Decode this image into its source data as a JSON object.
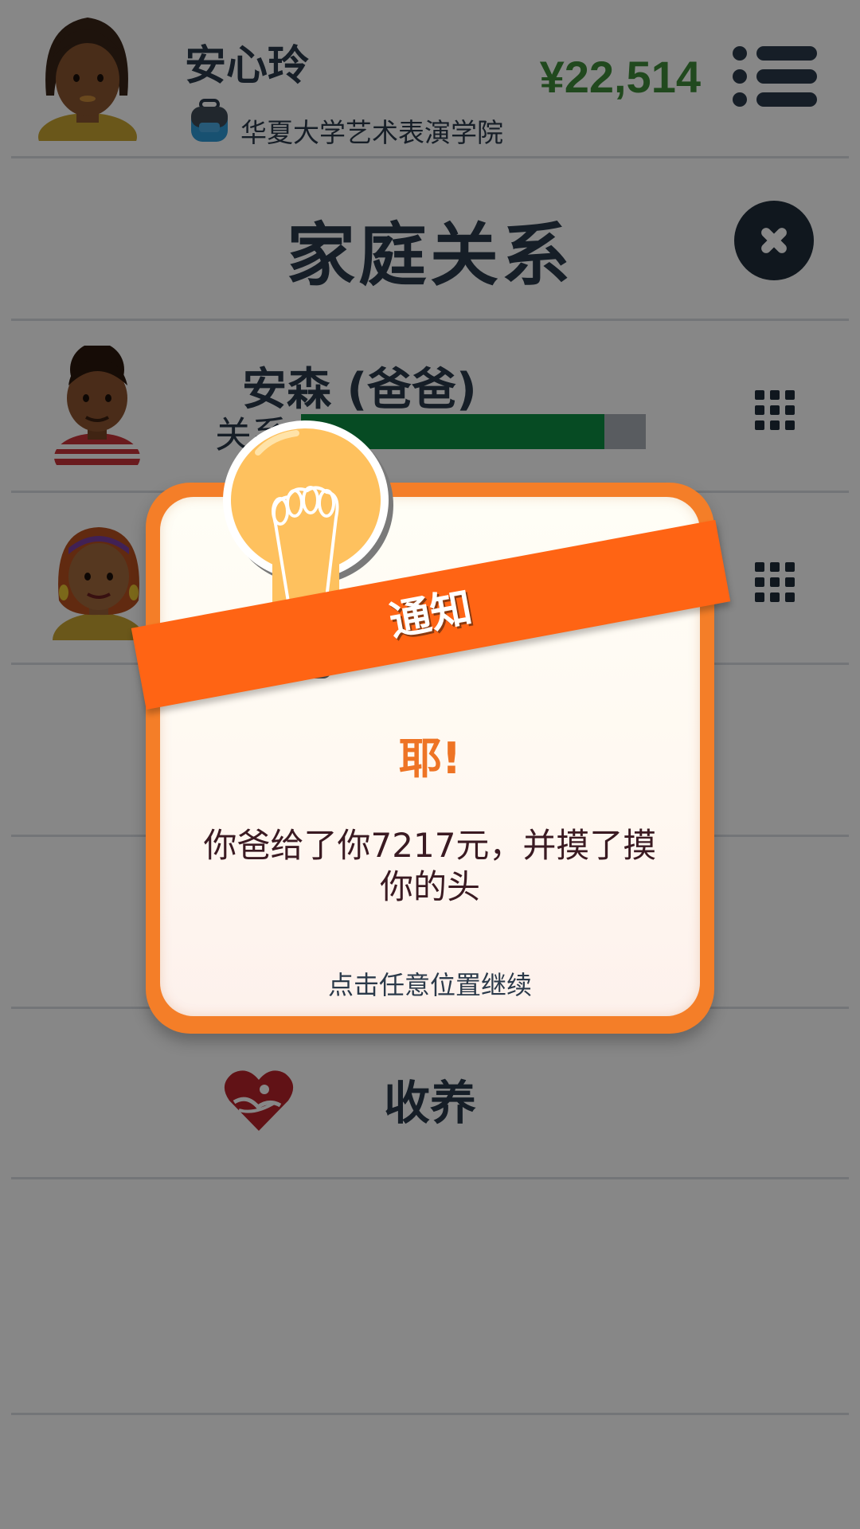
{
  "header": {
    "player_name": "安心玲",
    "school": "华夏大学艺术表演学院",
    "money": "¥22,514",
    "menu_icon": "hamburger-list-icon"
  },
  "page": {
    "title": "家庭关系",
    "close_icon": "close-x-icon"
  },
  "family": [
    {
      "name": "安森 (爸爸)",
      "relationship_label": "关系",
      "relationship_fraction": 0.88,
      "action_icon": "grid-dots-icon"
    },
    {
      "name": "",
      "action_icon": "grid-dots-icon"
    }
  ],
  "adopt": {
    "label": "收养",
    "icon": "heart-hands-icon"
  },
  "dialog": {
    "banner": "通知",
    "heading": "耶!",
    "message": "你爸给了你7217元，并摸了摸你的头",
    "hint": "点击任意位置继续",
    "icon": "lightbulb-icon"
  },
  "colors": {
    "money": "#3f8a3a",
    "relationship_bar": "#0d8f43",
    "dialog_frame": "#f47e28",
    "ribbon": "#ff6414",
    "heading": "#ee7425"
  }
}
